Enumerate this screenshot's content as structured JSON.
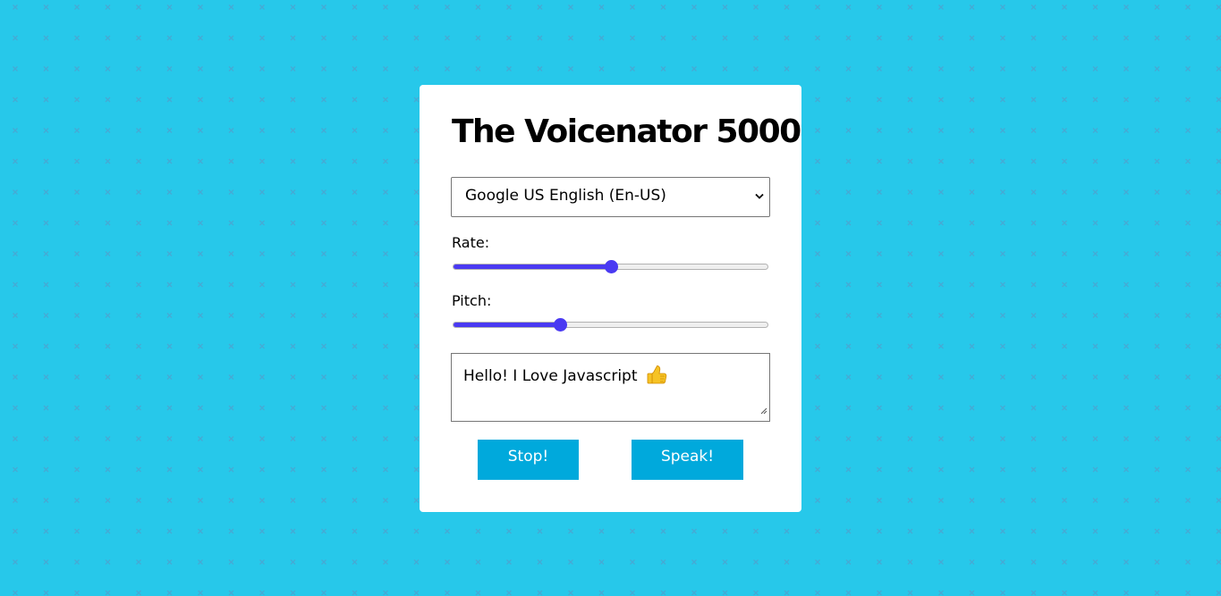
{
  "page": {
    "background_color": "#27c8ea",
    "pattern_icon": "x-mark-pattern"
  },
  "card": {
    "title": "The Voicenator 5000"
  },
  "voice_select": {
    "selected": "Google US English (En-US)",
    "icon": "chevron-down-icon"
  },
  "rate": {
    "label": "Rate:",
    "value_fraction": 0.5
  },
  "pitch": {
    "label": "Pitch:",
    "value_fraction": 0.34
  },
  "message": {
    "text": "Hello! I Love Javascript",
    "emoji_icon": "thumbs-up-icon"
  },
  "buttons": {
    "stop_label": "Stop!",
    "speak_label": "Speak!"
  },
  "colors": {
    "accent": "#4a3af2",
    "button": "#00a9dc",
    "card": "#ffffff"
  }
}
